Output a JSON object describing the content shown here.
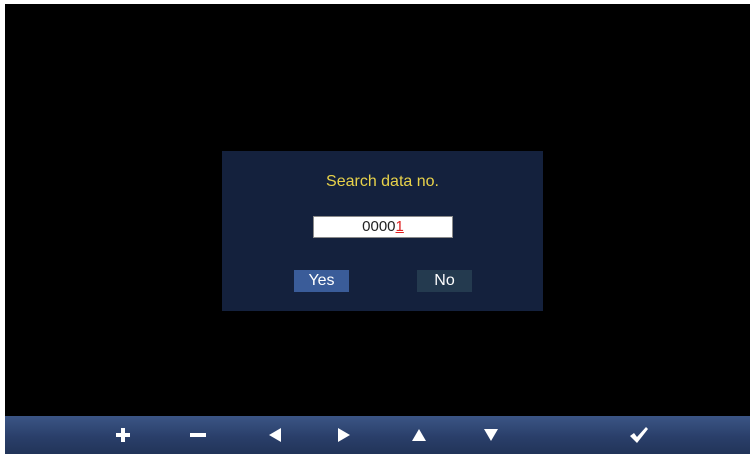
{
  "dialog": {
    "title": "Search data no.",
    "number_digits": "0000",
    "number_cursor_digit": "1",
    "yes_label": "Yes",
    "no_label": "No"
  },
  "toolbar": {
    "buttons": [
      {
        "icon": "plus-icon"
      },
      {
        "icon": "minus-icon"
      },
      {
        "icon": "arrow-left-icon"
      },
      {
        "icon": "arrow-right-icon"
      },
      {
        "icon": "arrow-up-icon"
      },
      {
        "icon": "arrow-down-icon"
      },
      {
        "icon": "checkmark-icon"
      }
    ]
  },
  "colors": {
    "screen_background": "#000000",
    "dialog_background": "#14213d",
    "title_text": "#e8d24a",
    "cursor_digit": "#e02020",
    "yes_button": "#3a5c99",
    "no_button": "#243a4f",
    "toolbar": "#2a3f6a"
  }
}
